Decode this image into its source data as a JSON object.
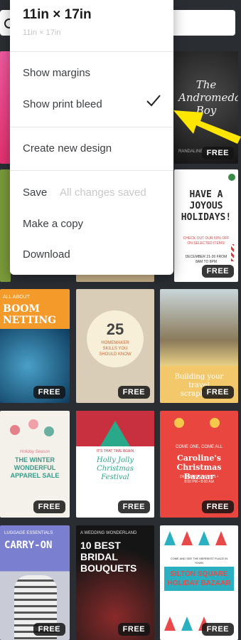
{
  "menu": {
    "title": "11in × 17in",
    "subtitle": "11in × 17in",
    "show_margins": "Show margins",
    "show_print_bleed": "Show print bleed",
    "create_new_design": "Create new design",
    "save": "Save",
    "save_status": "All changes saved",
    "make_copy": "Make a copy",
    "download": "Download"
  },
  "badge": "FREE",
  "templates": {
    "andromeda_title": "The Andromeda Boy",
    "andromeda_author": "RANDALINE GLICKE",
    "joyous": "HAVE A JOYOUS HOLIDAYS!",
    "joyous_sub": "CHECK OUT OUR 50% OFF ON SELECTED ITEMS!",
    "joyous_date": "DECEMBER 21-26 FROM 8AM TO 8PM",
    "boom_small": "ALL ABOUT",
    "boom": "BOOM NETTING",
    "homemaker_num": "25",
    "homemaker": "HOMEMAKER SKILLS YOU SHOULD KNOW",
    "scrapbook": "Building your travel scrapbook",
    "apparel_small": "Holiday Season",
    "apparel": "THE WINTER WONDERFUL APPAREL SALE",
    "holly_small": "IT'S THAT TIME AGAIN",
    "holly": "Holly Jolly Christmas Festival",
    "caroline_small": "COME ONE, COME ALL",
    "caroline": "Caroline's Christmas Bazaar",
    "caroline_date": "DECEMBER 7-8, 2021 • 8:00 PM • 8:00 AM",
    "carry_small": "LUGGAGE ESSENTIALS",
    "carry": "CARRY-ON",
    "bridal_small": "A WEDDING WONDERLAND",
    "bridal": "10 BEST BRIDAL BOUQUETS",
    "silton_small": "COME AND SEE THE MERRIEST PLACE IN TOWN",
    "silton": "SILTON SQUARE HOLIDAY BAZAAR"
  }
}
